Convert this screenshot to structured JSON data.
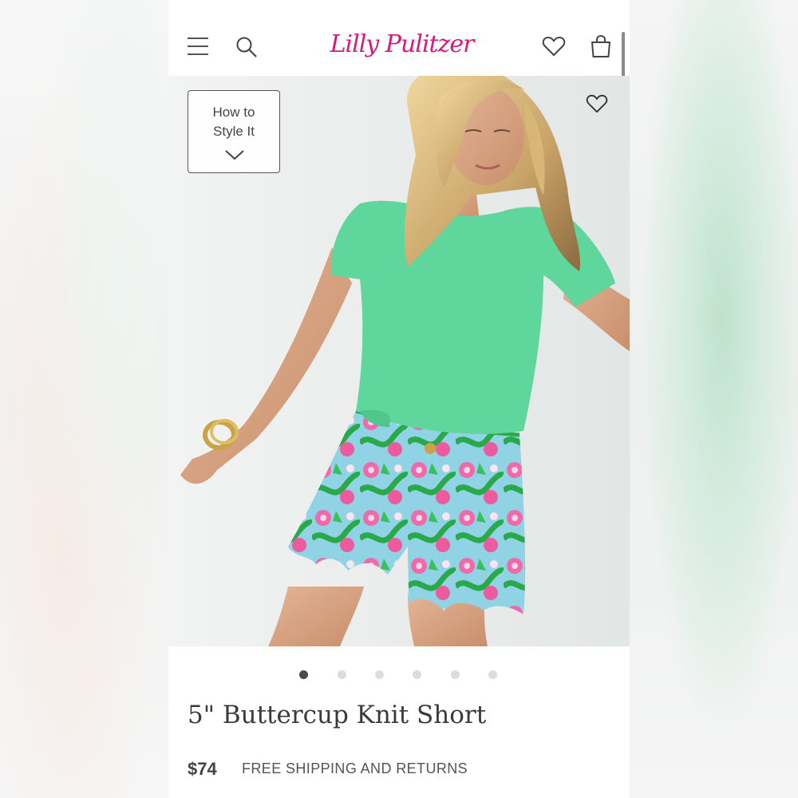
{
  "brand": {
    "logo_text": "Lilly Pulitzer",
    "logo_color": "#d6197a"
  },
  "header": {
    "menu_icon": "menu-icon",
    "search_icon": "search-icon",
    "wishlist_icon": "heart-icon",
    "bag_icon": "shopping-bag-icon"
  },
  "hero": {
    "style_it": {
      "line1": "How to",
      "line2": "Style It",
      "icon": "chevron-down-icon"
    },
    "favorite_icon": "heart-icon"
  },
  "carousel": {
    "total": 6,
    "active_index": 1
  },
  "product": {
    "title": "5\" Buttercup Knit Short",
    "price": "$74",
    "shipping": "FREE SHIPPING AND RETURNS"
  }
}
